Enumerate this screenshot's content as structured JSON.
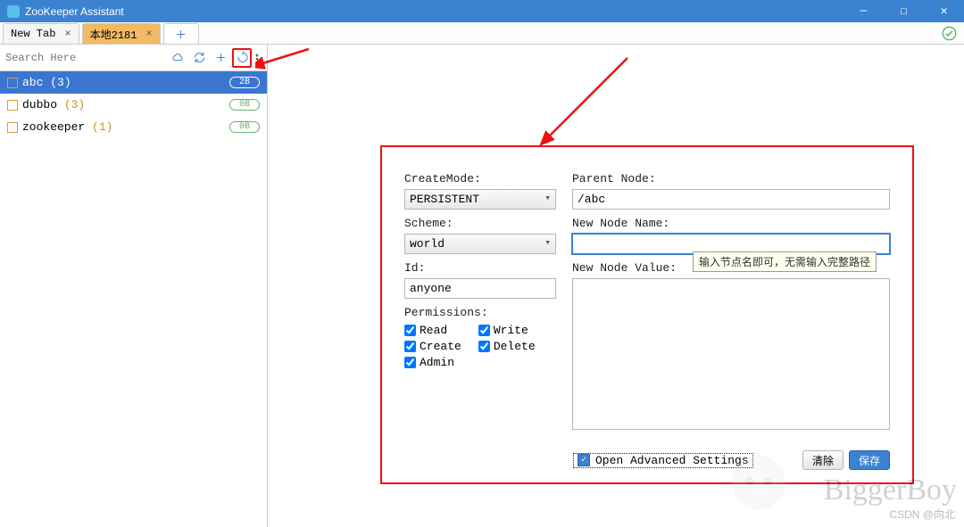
{
  "window": {
    "title": "ZooKeeper Assistant"
  },
  "tabs": {
    "tab0": "New Tab",
    "tab1": "本地2181"
  },
  "toolbox": {
    "search_placeholder": "Search Here"
  },
  "tree": {
    "items": [
      {
        "name": "abc",
        "count_display": "(3)",
        "badge": "2B"
      },
      {
        "name": "dubbo",
        "count_display": "(3)",
        "badge": "0B"
      },
      {
        "name": "zookeeper",
        "count_display": "(1)",
        "badge": "0B"
      }
    ]
  },
  "form": {
    "create_mode_label": "CreateMode:",
    "create_mode_value": "PERSISTENT",
    "scheme_label": "Scheme:",
    "scheme_value": "world",
    "id_label": "Id:",
    "id_value": "anyone",
    "permissions_label": "Permissions:",
    "perm_read": "Read",
    "perm_write": "Write",
    "perm_create": "Create",
    "perm_delete": "Delete",
    "perm_admin": "Admin",
    "parent_label": "Parent Node:",
    "parent_value": "/abc",
    "new_name_label": "New Node Name:",
    "new_name_value": "",
    "new_value_label": "New Node Value:",
    "new_value_value": "",
    "advanced_label": "Open Advanced Settings",
    "btn_clear": "清除",
    "btn_save": "保存",
    "tooltip": "输入节点名即可，无需输入完整路径"
  },
  "watermark": {
    "brand": "BiggerBoy",
    "csdn": "CSDN @向北"
  }
}
